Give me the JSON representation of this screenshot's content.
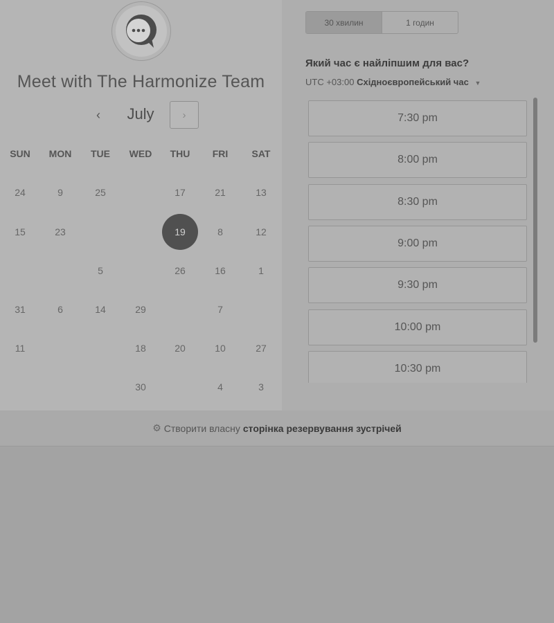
{
  "header": {
    "title": "Meet with The Harmonize Team"
  },
  "calendar": {
    "month": "July",
    "prev_symbol": "‹",
    "next_symbol": "›",
    "weekdays": [
      "SUN",
      "MON",
      "TUE",
      "WED",
      "THU",
      "FRI",
      "SAT"
    ],
    "selected_day": "19",
    "rows": [
      [
        "24",
        "9",
        "25",
        "",
        "17",
        "21",
        "13"
      ],
      [
        "15",
        "23",
        "",
        "",
        "19",
        "8",
        "12"
      ],
      [
        "",
        "",
        "5",
        "",
        "26",
        "16",
        "1"
      ],
      [
        "31",
        "6",
        "14",
        "29",
        "",
        "7",
        ""
      ],
      [
        "11",
        "",
        "",
        "18",
        "20",
        "10",
        "27"
      ],
      [
        "",
        "",
        "",
        "30",
        "",
        "4",
        "3"
      ]
    ]
  },
  "duration": {
    "options": [
      "30 хвилин",
      "1 годин"
    ],
    "selected": "30 хвилин"
  },
  "scheduler": {
    "question": "Який час є найліпшим для вас?",
    "timezone_offset": "UTC +03:00",
    "timezone_name": "Східноєвропейський час",
    "slots": [
      "7:30 pm",
      "8:00 pm",
      "8:30 pm",
      "9:00 pm",
      "9:30 pm",
      "10:00 pm",
      "10:30 pm"
    ]
  },
  "footer": {
    "text": "Створити власну",
    "bold_text": "сторінка резервування зустрічей"
  },
  "colors": {
    "selected_day_bg": "#505050",
    "page_bg": "#a3a3a3"
  },
  "icons": {
    "avatar": "chat-bubble-icon",
    "footer": "sprocket-icon"
  }
}
